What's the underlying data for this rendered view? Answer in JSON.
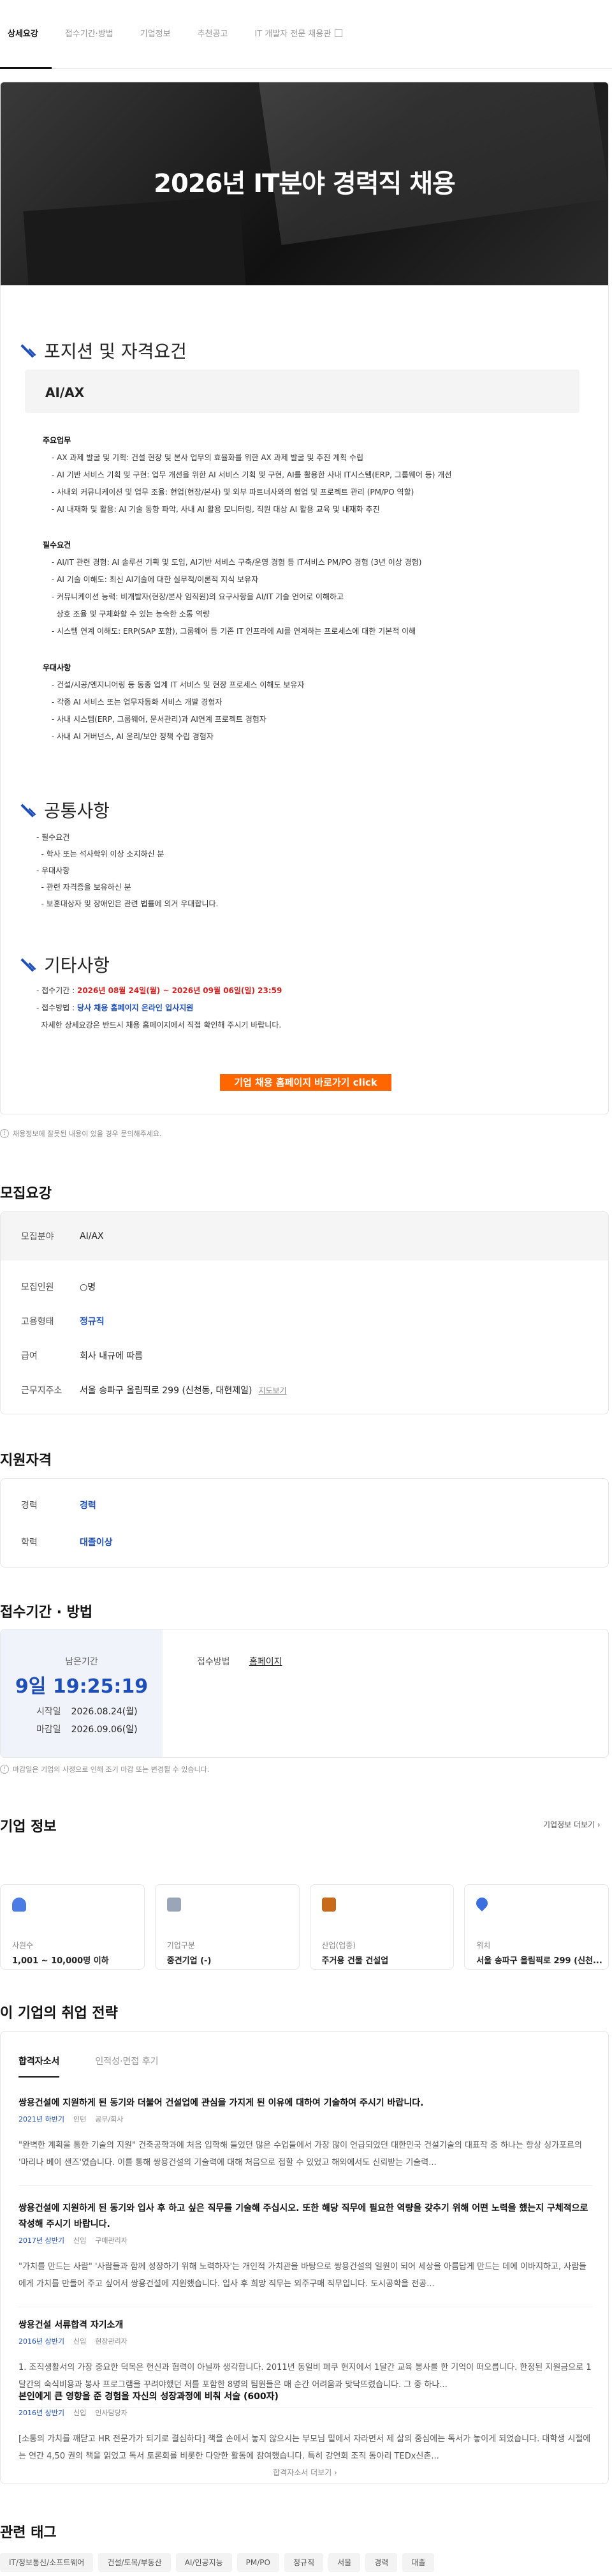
{
  "tabs": [
    "상세요강",
    "접수기간·방법",
    "기업정보",
    "추천공고",
    "IT 개발자 전문 채용관"
  ],
  "hero": {
    "title": "2026년 IT분야 경력직 채용"
  },
  "posting": {
    "section1_title": "포지션 및 자격요건",
    "role": "AI/AX",
    "duties_title": "주요업무",
    "duties": [
      "- AX 과제 발굴 및 기획: 건설 현장 및 본사 업무의 효율화를 위한 AX 과제 발굴 및 추진 계획 수립",
      "- AI 기반 서비스 기획 및 구현: 업무 개선을 위한 AI 서비스 기획 및 구현, AI를 활용한 사내 IT시스템(ERP, 그룹웨어 등) 개선",
      "- 사내외 커뮤니케이션 및 업무 조율: 현업(현장/본사) 및 외부 파트너사와의 협업 및 프로젝트 관리 (PM/PO 역할)",
      "- AI 내재화 및 활용: AI 기술 동향 파악, 사내 AI 활용 모니터링, 직원 대상 AI 활용 교육 및 내재화 추진"
    ],
    "reqs_title": "필수요건",
    "reqs": [
      "- AI/IT 관련 경험: AI 솔루션 기획 및 도입, AI기반 서비스 구축/운영 경험 등 IT서비스 PM/PO 경험 (3년 이상 경험)",
      "- AI 기술 이해도: 최신 AI기술에 대한 실무적/이론적 지식 보유자",
      "- 커뮤니케이션 능력: 비개발자(현장/본사 임직원)의 요구사항을 AI/IT 기술 언어로 이해하고",
      "  상호 조율 및 구체화할 수 있는 능숙한 소통 역량",
      "- 시스템 연계 이해도: ERP(SAP 포함), 그룹웨어 등 기존 IT 인프라에 AI를 연계하는 프로세스에 대한 기본적 이해"
    ],
    "pref_title": "우대사항",
    "prefs": [
      "- 건설/시공/엔지니어링 등 동종 업계 IT 서비스 및 현장 프로세스 이해도 보유자",
      "- 각종 AI 서비스 또는 업무자동화 서비스 개발 경험자",
      "- 사내 시스템(ERP, 그룹웨어, 문서관리)과 AI연계 프로젝트 경험자",
      "- 사내 AI 거버넌스, AI 윤리/보안 정책 수립 경험자"
    ],
    "section2_title": "공통사항",
    "common": [
      "- 필수요건",
      "  - 학사 또는 석사학위 이상 소지하신 분",
      "- 우대사항",
      "  - 관련 자격증을 보유하신 분",
      "  - 보훈대상자 및 장애인은 관련 법률에 의거 우대합니다."
    ],
    "section3_title": "기타사항",
    "period_label": "- 접수기간 : ",
    "period_value": "2026년 08월 24일(월) ~ 2026년 09월 06일(일) 23:59",
    "method_label": "- 접수방법 : ",
    "method_value": "당사 채용 홈페이지 온라인 입사지원",
    "detail_note": "  자세한 상세요강은 반드시 채용 홈페이지에서 직접 확인해 주시기 바랍니다.",
    "cta": "기업 채용 홈페이지 바로가기 click"
  },
  "note_changes": "채용정보에 잘못된 내용이 있을 경우 문의해주세요.",
  "summary": {
    "title": "모집요강",
    "rows": [
      {
        "k": "모집분야",
        "v": "AI/AX"
      },
      {
        "k": "모집인원",
        "v": "○명"
      },
      {
        "k": "고용형태",
        "v": "정규직"
      },
      {
        "k": "급여",
        "v": "회사 내규에 따름"
      },
      {
        "k": "근무지주소",
        "v": "서울 송파구 올림픽로 299 (신천동, 대현제일)"
      }
    ],
    "map_link": "지도보기"
  },
  "qualification": {
    "title": "지원자격",
    "rows": [
      {
        "k": "경력",
        "v": "경력"
      },
      {
        "k": "학력",
        "v": "대졸이상"
      }
    ]
  },
  "schedule": {
    "title": "접수기간 · 방법",
    "remaining_label": "남은기간",
    "countdown": "9일 19:25:19",
    "start_label": "시작일",
    "start": "2026.08.24(월)",
    "end_label": "마감일",
    "end": "2026.09.06(일)",
    "method_label": "접수방법",
    "method": "홈페이지",
    "note": "마감일은 기업의 사정으로 인해 조기 마감 또는 변경될 수 있습니다."
  },
  "company": {
    "title": "기업 정보",
    "more": "기업정보 더보기",
    "cards": [
      {
        "icon": "people-icon",
        "label": "사원수",
        "value": "1,001 ~ 10,000명 이하",
        "color": "#4b7be5"
      },
      {
        "icon": "building-icon",
        "label": "기업구분",
        "value": "중견기업 (-)",
        "color": "#9aa5b8"
      },
      {
        "icon": "briefcase-icon",
        "label": "산업(업종)",
        "value": "주거용 건물 건설업",
        "color": "#c96a1a"
      },
      {
        "icon": "location-pin-icon",
        "label": "위치",
        "value": "서울 송파구 올림픽로 299 (신천...",
        "color": "#3b6fe0"
      }
    ]
  },
  "strategy": {
    "title": "이 기업의 취업 전략",
    "tabs": [
      "합격자소서",
      "인적성·면접 후기"
    ],
    "essays": [
      {
        "q": "쌍용건설에 지원하게 된 동기와 더불어 건설업에 관심을 가지게 된 이유에 대하여 기술하여 주시기 바랍니다.",
        "year": "2021년 하반기",
        "type": "인턴",
        "dept": "공무/회사",
        "a": "\"완벽한 계획을 통한 기술의 지원\" 건축공학과에 처음 입학해 들었던 많은 수업들에서 가장 많이 언급되었던 대한민국 건설기술의 대표작 중 하나는 항상 싱가포르의 '마리나 베이 샌즈'였습니다. 이를 통해 쌍용건설의 기술력에 대해 처음으로 접할 수 있었고 해외에서도 신뢰받는 기술력..."
      },
      {
        "q": "쌍용건설에 지원하게 된 동기와 입사 후 하고 싶은 직무를 기술해 주십시오. 또한 해당 직무에 필요한 역량을 갖추기 위해 어떤 노력을 했는지 구체적으로 작성해 주시기 바랍니다.",
        "year": "2017년 상반기",
        "type": "신입",
        "dept": "구매관리자",
        "a": "\"가치를 만드는 사람\" '사람들과 함께 성장하기 위해 노력하자'는 개인적 가치관을 바탕으로 쌍용건설의 일원이 되어 세상을 아름답게 만드는 데에 이바지하고, 사람들에게 가치를 만들어 주고 싶어서 쌍용건설에 지원했습니다. 입사 후 희망 직무는 외주구매 직무입니다. 도시공학을 전공..."
      },
      {
        "q": "쌍용건설 서류합격 자기소개",
        "year": "2016년 상반기",
        "type": "신입",
        "dept": "현장관리자",
        "a": "1. 조직생활서의 가장 중요한 덕목은 헌신과 협력이 아닐까 생각합니다. 2011년 동일비 폐쿠 현지에서 1달간 교육 봉사를 한 기억이 떠오릅니다. 한정된 지원금으로 1달간의 숙식비용과 봉사 프로그램을 꾸려야했던 저를 포함한 8명의 팀원들은 매 순간 어려움과 맞닥뜨렸습니다. 그 중 하나..."
      },
      {
        "q": "본인에게 큰 영향을 준 경험을 자신의 성장과정에 비춰 서술 (600자)",
        "year": "2016년 상반기",
        "type": "신입",
        "dept": "인사담당자",
        "a": "[소통의 가치를 깨닫고 HR 전문가가 되기로 결심하다] 책을 손에서 놓지 않으시는 부모님 밑에서 자라면서 제 삶의 중심에는 독서가 놓이게 되었습니다. 대학생 시절에는 연간 4,50 권의 책을 읽었고 독서 토론회를 비롯한 다양한 활동에 참여했습니다. 특히 강연회 조직 동아리 TEDx신촌..."
      }
    ],
    "more": "합격자소서 더보기"
  },
  "tags": {
    "title": "관련 태그",
    "items": [
      "IT/정보통신/소프트웨어",
      "건설/토목/부동산",
      "AI/인공지능",
      "PM/PO",
      "정규직",
      "서울",
      "경력",
      "대졸"
    ]
  }
}
